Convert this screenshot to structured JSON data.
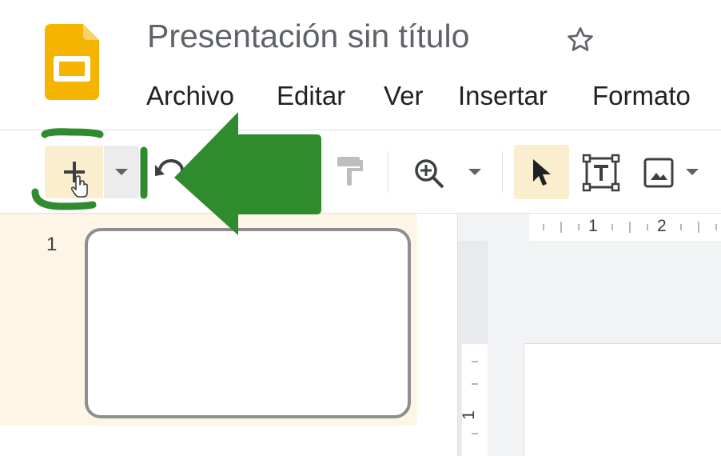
{
  "app": {
    "title": "Presentación sin título",
    "logo_icon": "google-slides-logo-icon",
    "brand_color": "#f4b400"
  },
  "menu": {
    "items": [
      "Archivo",
      "Editar",
      "Ver",
      "Insertar",
      "Formato"
    ]
  },
  "toolbar": {
    "icons": [
      "plus-icon",
      "chevron-down-icon",
      "undo-icon",
      "paint-format-icon",
      "zoom-icon",
      "chevron-down-icon",
      "cursor-select-icon",
      "text-box-icon",
      "image-icon",
      "chevron-down-icon"
    ],
    "highlight_color": "#fbeecf"
  },
  "annotation": {
    "arrow_color": "#2e8b2e",
    "icon": "left-arrow-annotation-icon"
  },
  "filmstrip": {
    "slides": [
      {
        "number": "1"
      }
    ]
  },
  "ruler": {
    "top_labels": [
      "1",
      "2"
    ],
    "left_labels": [
      "1"
    ]
  }
}
